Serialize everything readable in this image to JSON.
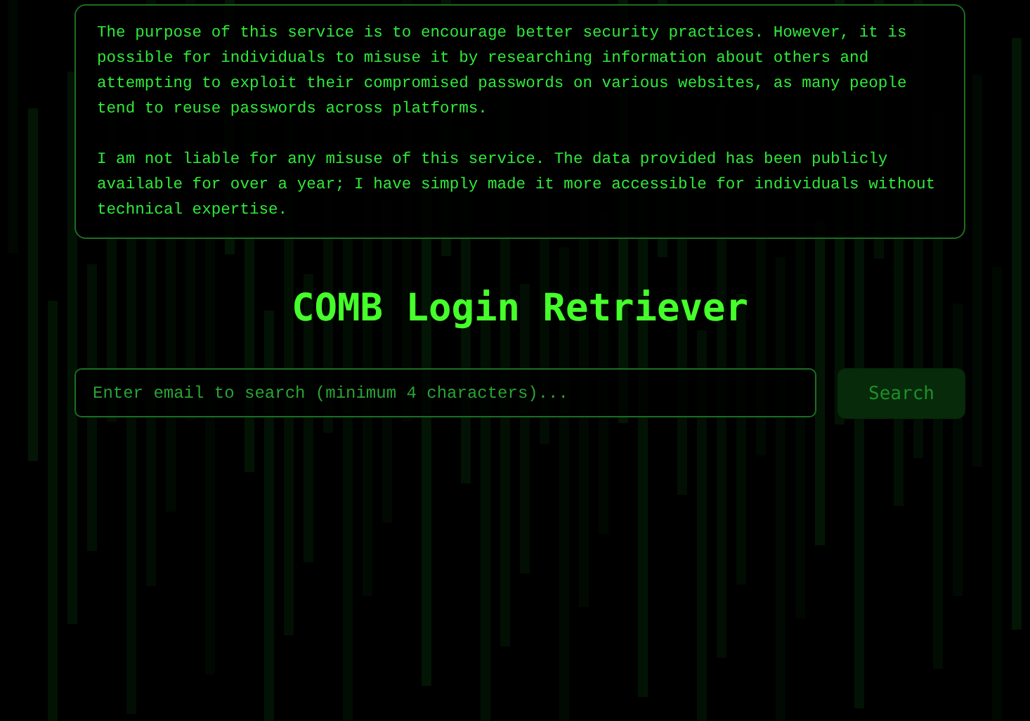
{
  "notice": {
    "paragraphs": [
      "The purpose of this service is to encourage better security practices. However, it is possible for individuals to misuse it by researching information about others and attempting to exploit their compromised passwords on various websites, as many people tend to reuse passwords across platforms.",
      "I am not liable for any misuse of this service. The data provided has been publicly available for over a year; I have simply made it more accessible for individuals without technical expertise."
    ]
  },
  "title": "COMB Login Retriever",
  "search": {
    "placeholder": "Enter email to search (minimum 4 characters)...",
    "button": "Search"
  }
}
